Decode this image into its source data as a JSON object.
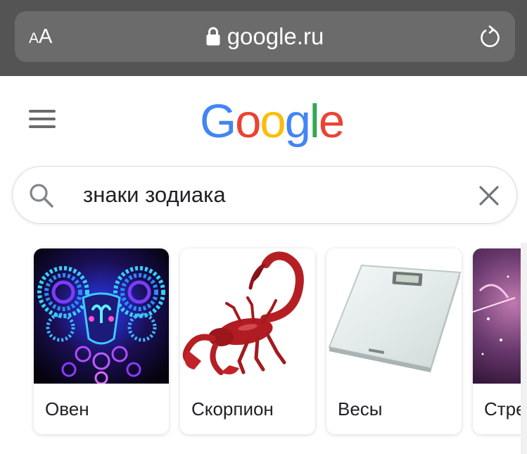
{
  "browser": {
    "text_size_small": "A",
    "text_size_big": "A",
    "address": "google.ru",
    "icons": [
      "text-size-icon",
      "lock-icon",
      "reload-icon"
    ]
  },
  "google": {
    "logo": [
      "G",
      "o",
      "o",
      "g",
      "l",
      "e"
    ],
    "logo_colors": [
      "#4285F4",
      "#EA4335",
      "#FBBC05",
      "#4285F4",
      "#34A853",
      "#EA4335"
    ],
    "menu_icon": "hamburger-menu-icon"
  },
  "search": {
    "query": "знаки зодиака",
    "icons": [
      "search-icon",
      "clear-icon"
    ]
  },
  "carousel": {
    "items": [
      {
        "label": "Овен",
        "image": "aries-ram-neon"
      },
      {
        "label": "Скорпион",
        "image": "red-scorpion"
      },
      {
        "label": "Весы",
        "image": "bathroom-scale"
      },
      {
        "label": "Стре",
        "image": "sagittarius-archer"
      }
    ]
  }
}
